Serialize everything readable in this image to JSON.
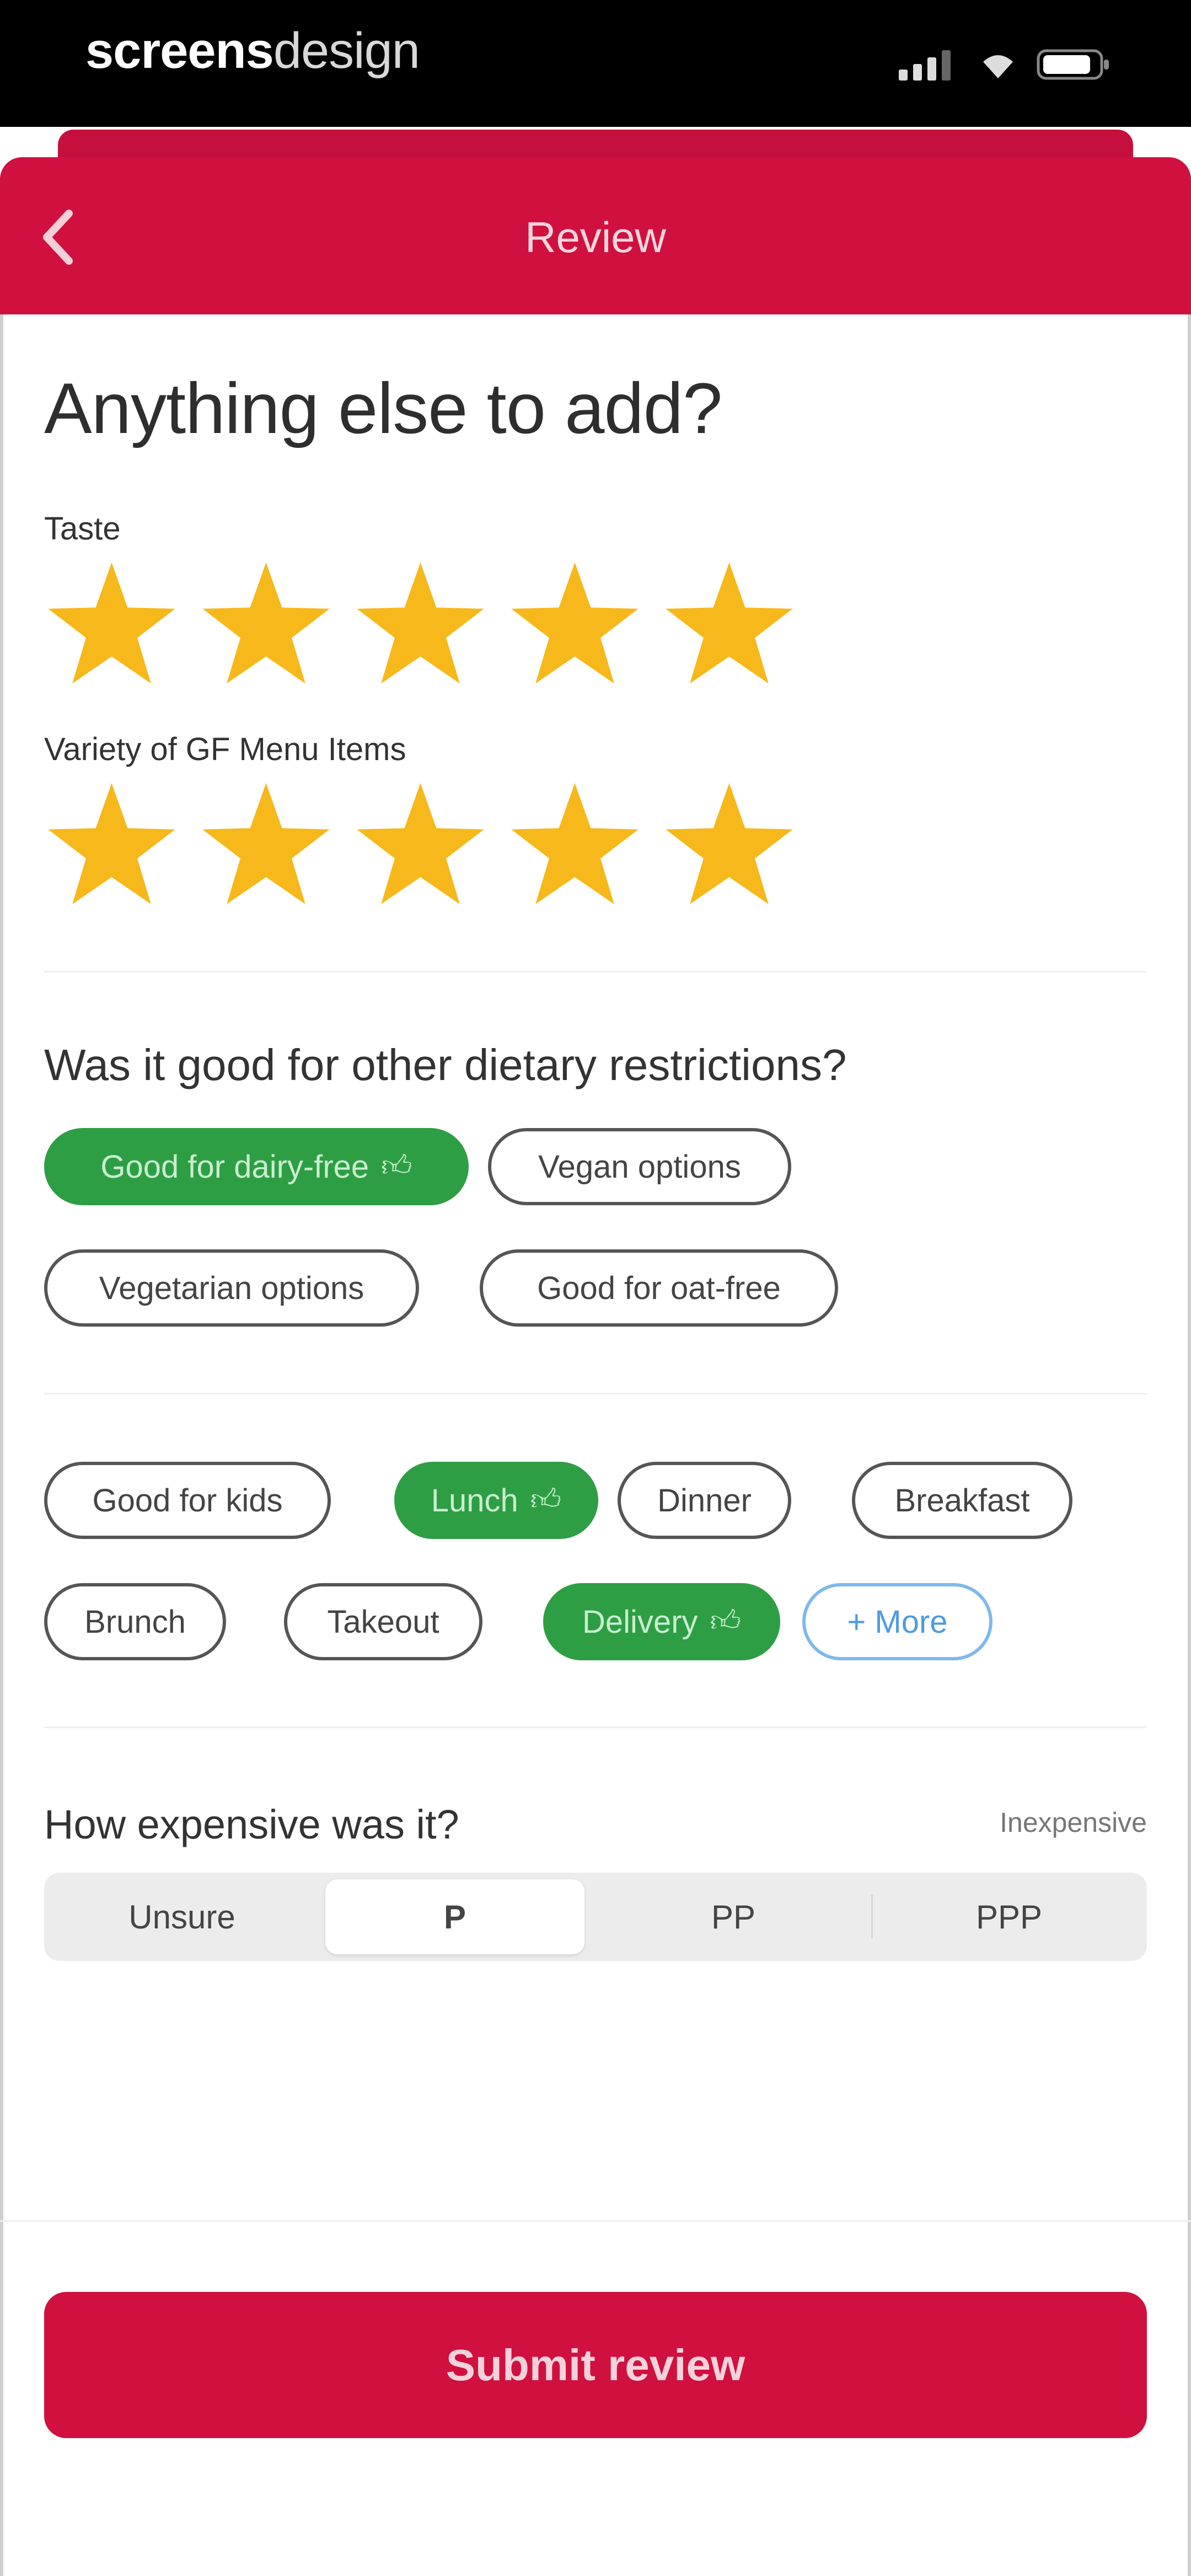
{
  "status_bar": {
    "brand_bold": "screens",
    "brand_light": "design"
  },
  "header": {
    "title": "Review",
    "back_icon": "chevron-left-icon"
  },
  "page": {
    "title": "Anything else to add?"
  },
  "ratings": [
    {
      "label": "Taste",
      "value": 5,
      "max": 5
    },
    {
      "label": "Variety of GF Menu Items",
      "value": 5,
      "max": 5
    }
  ],
  "dietary": {
    "question": "Was it good for other dietary restrictions?",
    "chips": [
      {
        "label": "Good for dairy-free",
        "selected": true,
        "icon": "thumbs-up-icon"
      },
      {
        "label": "Vegan options",
        "selected": false
      },
      {
        "label": "Vegetarian options",
        "selected": false
      },
      {
        "label": "Good for oat-free",
        "selected": false
      }
    ]
  },
  "tags": {
    "chips": [
      {
        "label": "Good for kids",
        "selected": false
      },
      {
        "label": "Lunch",
        "selected": true,
        "icon": "thumbs-up-icon"
      },
      {
        "label": "Dinner",
        "selected": false
      },
      {
        "label": "Breakfast",
        "selected": false
      },
      {
        "label": "Brunch",
        "selected": false
      },
      {
        "label": "Takeout",
        "selected": false
      },
      {
        "label": "Delivery",
        "selected": true,
        "icon": "thumbs-up-icon"
      },
      {
        "label": "+ More",
        "selected": false
      }
    ]
  },
  "price": {
    "question": "How expensive was it?",
    "hint": "Inexpensive",
    "options": [
      "Unsure",
      "P",
      "PP",
      "PPP"
    ],
    "selected": "P"
  },
  "submit_label": "Submit review",
  "colors": {
    "brand_red": "#d0103f",
    "selected_green": "#2e9e44",
    "star_yellow": "#f6b81a",
    "more_blue": "#4e9be0"
  }
}
